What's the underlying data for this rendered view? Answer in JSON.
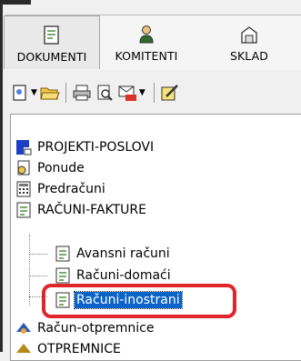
{
  "tabs": [
    {
      "label": "DOKUMENTI",
      "icon": "document-icon",
      "active": true
    },
    {
      "label": "KOMITENTI",
      "icon": "person-icon",
      "active": false
    },
    {
      "label": "SKLAD",
      "icon": "warehouse-icon",
      "active": false
    }
  ],
  "toolbar": {
    "buttons": [
      "new-document-icon",
      "open-folder-icon",
      "print-icon",
      "print-preview-icon",
      "pdf-mail-icon",
      "edit-icon"
    ]
  },
  "tree": {
    "items": [
      {
        "label": "PROJEKTI-POSLOVI",
        "icon": "projects-icon"
      },
      {
        "label": "Ponude",
        "icon": "offer-icon"
      },
      {
        "label": "Predračuni",
        "icon": "calculator-icon"
      },
      {
        "label": "RAČUNI-FAKTURE",
        "icon": "invoice-icon"
      },
      {
        "label": "Avansni računi",
        "icon": "invoice-icon"
      },
      {
        "label": "Računi-domaći",
        "icon": "invoice-icon"
      },
      {
        "label": "Računi-inostrani",
        "icon": "invoice-icon",
        "selected": true
      },
      {
        "label": "Račun-otpremnice",
        "icon": "delivery-icon"
      },
      {
        "label": "OTPREMNICE",
        "icon": "delivery-icon"
      }
    ]
  },
  "colors": {
    "selection": "#0a64c8",
    "highlight_ring": "#e0252b"
  }
}
